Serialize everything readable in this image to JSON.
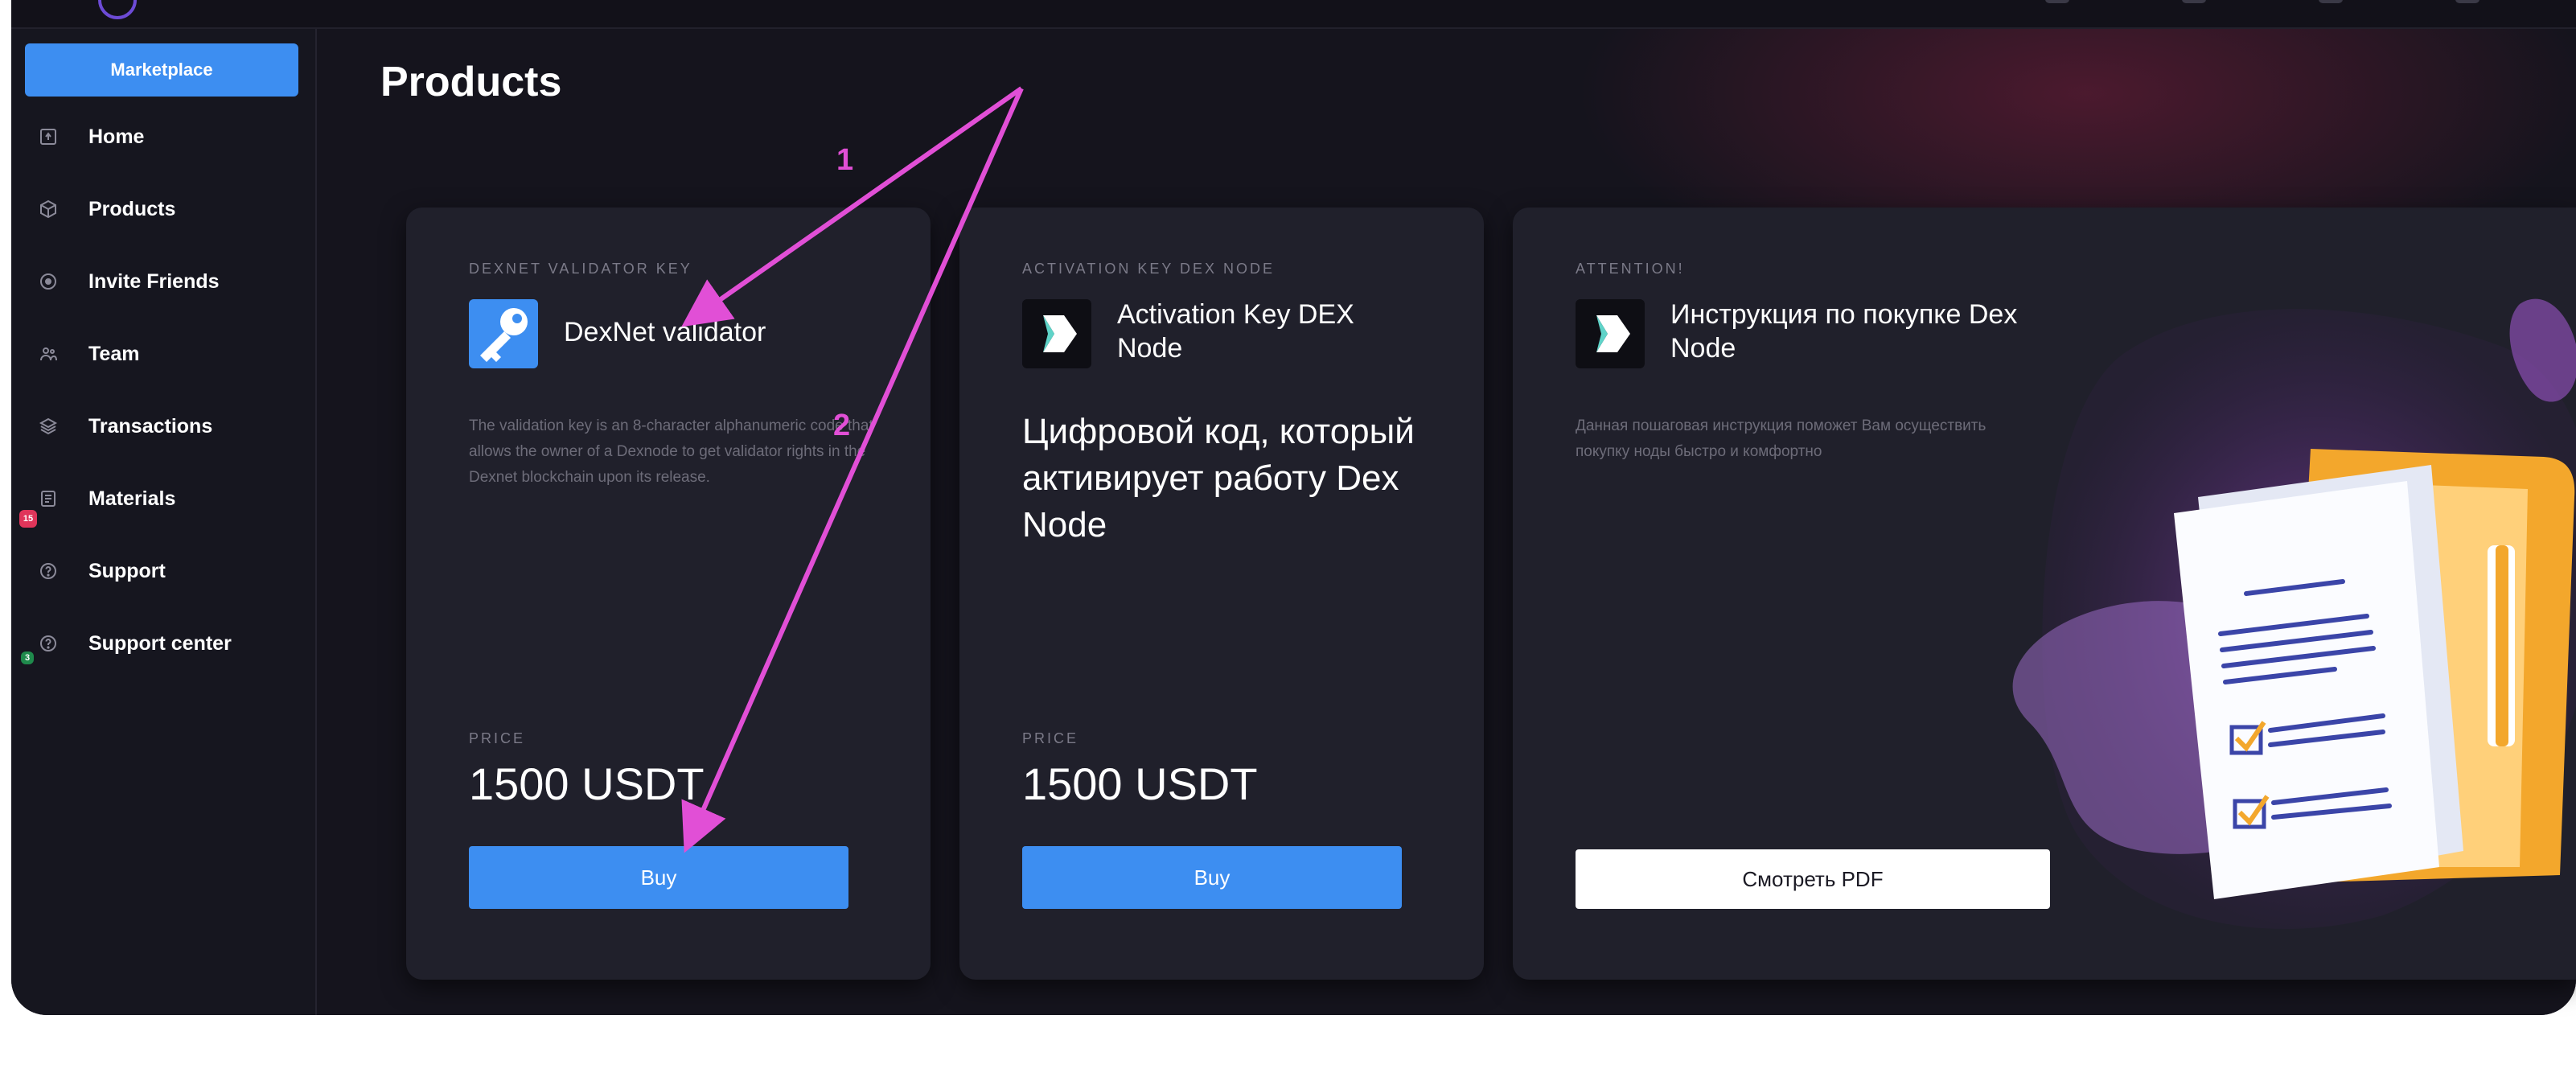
{
  "sidebar": {
    "marketplace_label": "Marketplace",
    "items": [
      {
        "label": "Home",
        "icon": "home-icon"
      },
      {
        "label": "Products",
        "icon": "cube-icon"
      },
      {
        "label": "Invite Friends",
        "icon": "target-icon"
      },
      {
        "label": "Team",
        "icon": "team-icon"
      },
      {
        "label": "Transactions",
        "icon": "layers-icon"
      },
      {
        "label": "Materials",
        "icon": "document-icon",
        "badge": "15"
      },
      {
        "label": "Support",
        "icon": "help-icon"
      },
      {
        "label": "Support center",
        "icon": "help-icon",
        "badge": "3"
      }
    ]
  },
  "page": {
    "title": "Products"
  },
  "cards": [
    {
      "eyebrow": "DEXNET VALIDATOR KEY",
      "title": "DexNet validator",
      "description": "The validation key is an 8-character alphanumeric code that allows the owner of a Dexnode to get validator rights in the Dexnet blockchain upon its release.",
      "price_label": "PRICE",
      "price": "1500 USDT",
      "button": "Buy",
      "icon": "key-icon",
      "icon_bg": "#3d8ef1"
    },
    {
      "eyebrow": "ACTIVATION KEY DEX NODE",
      "title": "Activation Key DEX Node",
      "description": "Цифровой код, который активирует работу Dex Node",
      "price_label": "PRICE",
      "price": "1500 USDT",
      "button": "Buy",
      "icon": "dexnet-logo-icon",
      "icon_bg": "#0e0e14"
    },
    {
      "eyebrow": "ATTENTION!",
      "title": "Инструкция по покупке Dex Node",
      "description": "Данная пошаговая инструкция поможет Вам осуществить покупку ноды быстро и комфортно",
      "button": "Смотреть PDF",
      "icon": "dexnet-logo-icon",
      "icon_bg": "#0e0e14"
    }
  ],
  "annotations": [
    {
      "label": "1"
    },
    {
      "label": "2"
    }
  ],
  "colors": {
    "accent": "#3d8ef1",
    "annotation": "#e14fd6",
    "background": "#15141d",
    "card": "#20202b"
  }
}
